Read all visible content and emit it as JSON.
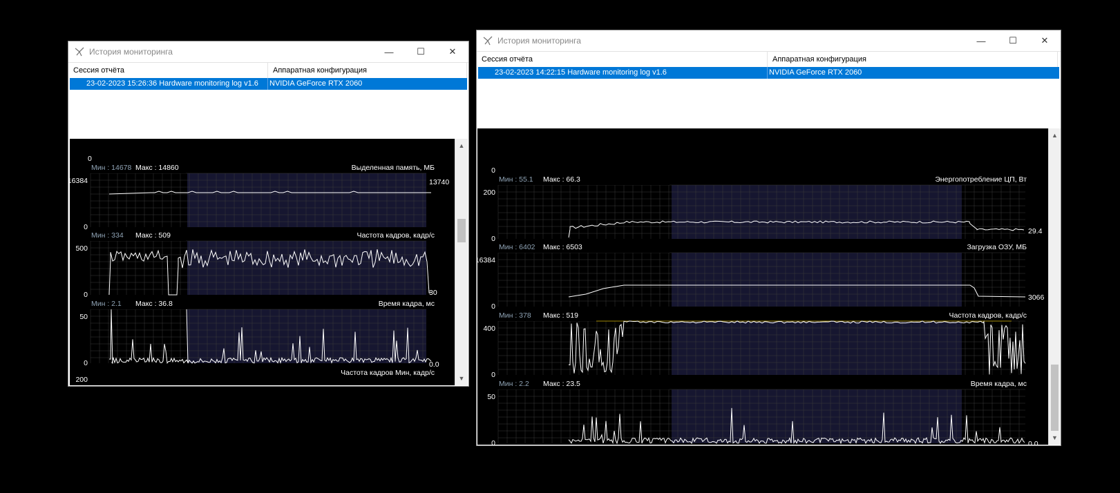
{
  "colors": {
    "selection": "#0078d7",
    "grid": "#3a3a3a",
    "highlight": "#161630",
    "trace": "#ffffff",
    "min_label": "#8fa3b5"
  },
  "windows": [
    {
      "title": "История мониторинга",
      "columns": [
        "Сессия отчёта",
        "Аппаратная конфигурация"
      ],
      "row": {
        "session": "23-02-2023 15:26:36 Hardware monitoring log v1.6",
        "hardware": "NVIDIA GeForce RTX 2060"
      },
      "graphs": [
        {
          "title": "Выделенная память, МБ",
          "min_label": "Мин : 14678",
          "max_label": "Макс : 14860",
          "axis_top": "16384",
          "axis_bottom": "0",
          "current": "13740",
          "kind": "flat"
        },
        {
          "title": "Частота кадров, кадр/с",
          "min_label": "Мин : 334",
          "max_label": "Макс : 509",
          "axis_top": "500",
          "axis_bottom": "0",
          "current": "30",
          "kind": "fps"
        },
        {
          "title": "Время кадра, мс",
          "min_label": "Мин : 2.1",
          "max_label": "Макс : 36.8",
          "axis_top": "50",
          "axis_bottom": "0",
          "current": "0.0",
          "kind": "spikes"
        }
      ],
      "top_cut_label": "0",
      "bottom_cut_title": "Частота кадров Мин, кадр/с",
      "bottom_cut_label": "200"
    },
    {
      "title": "История мониторинга",
      "columns": [
        "Сессия отчёта",
        "Аппаратная конфигурация"
      ],
      "row": {
        "session": "23-02-2023 14:22:15 Hardware monitoring log v1.6",
        "hardware": "NVIDIA GeForce RTX 2060"
      },
      "graphs": [
        {
          "title": "Энергопотребление ЦП, Вт",
          "min_label": "Мин : 55.1",
          "max_label": "Макс : 66.3",
          "axis_top": "200",
          "axis_bottom": "0",
          "current": "29.4",
          "kind": "power"
        },
        {
          "title": "Загрузка ОЗУ, МБ",
          "min_label": "Мин : 6402",
          "max_label": "Макс : 6503",
          "axis_top": "16384",
          "axis_bottom": "0",
          "current": "3066",
          "kind": "ram"
        },
        {
          "title": "Частота кадров, кадр/с",
          "min_label": "Мин : 378",
          "max_label": "Макс : 519",
          "axis_top": "400",
          "axis_bottom": "0",
          "current": "",
          "kind": "fps2"
        },
        {
          "title": "Время кадра, мс",
          "min_label": "Мин : 2.2",
          "max_label": "Макс : 23.5",
          "axis_top": "50",
          "axis_bottom": "0",
          "current": "0.0",
          "kind": "spikes2"
        }
      ],
      "top_cut_label": "0"
    }
  ]
}
